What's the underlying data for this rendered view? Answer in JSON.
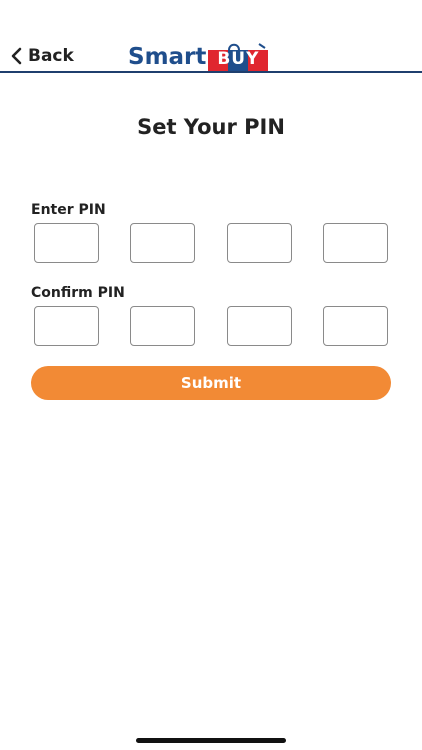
{
  "header": {
    "back_label": "Back",
    "logo_text_smart": "Smart",
    "logo_text_buy": "BUY",
    "brand_blue": "#1f4e8c",
    "brand_red": "#e0262f",
    "divider_color": "#1f3f6e"
  },
  "page": {
    "title": "Set Your PIN"
  },
  "enter_pin": {
    "label": "Enter PIN",
    "digits": [
      "",
      "",
      "",
      ""
    ]
  },
  "confirm_pin": {
    "label": "Confirm PIN",
    "digits": [
      "",
      "",
      "",
      ""
    ]
  },
  "submit": {
    "label": "Submit",
    "color": "#f28a35"
  },
  "icons": {
    "back": "chevron-left-icon"
  }
}
